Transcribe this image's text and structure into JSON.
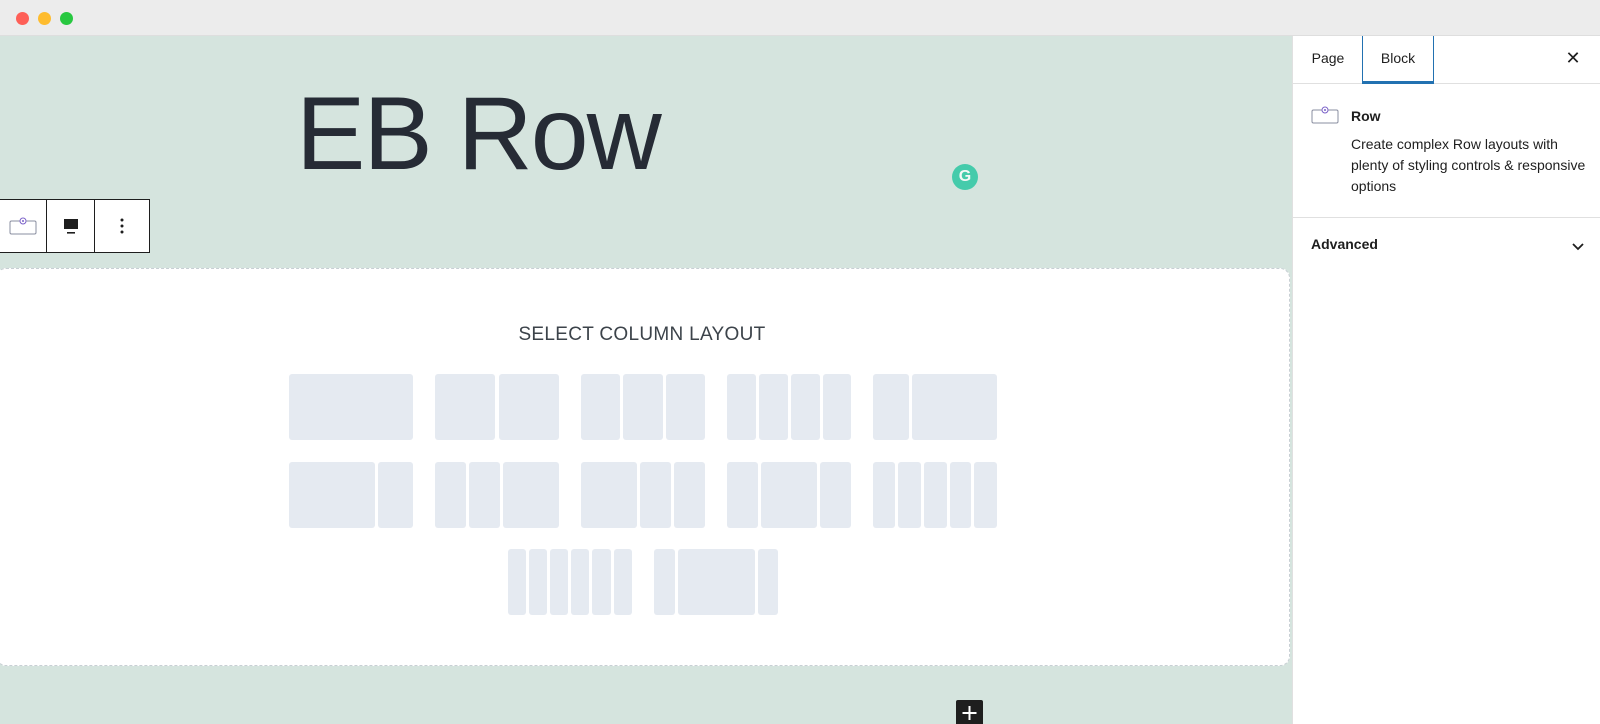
{
  "canvas": {
    "heading": "EB Row",
    "layout_title": "SELECT COLUMN LAYOUT",
    "layout_options": [
      {
        "name": "layout-1-col"
      },
      {
        "name": "layout-2-equal"
      },
      {
        "name": "layout-3-equal"
      },
      {
        "name": "layout-4-equal"
      },
      {
        "name": "layout-narrow-wide"
      },
      {
        "name": "layout-wide-narrow"
      },
      {
        "name": "layout-narrow-narrow-wide"
      },
      {
        "name": "layout-wide-narrow-narrow"
      },
      {
        "name": "layout-narrow-wide-narrow"
      },
      {
        "name": "layout-5-equal"
      },
      {
        "name": "layout-6-equal"
      },
      {
        "name": "layout-narrow-wide-narrow-alt"
      }
    ]
  },
  "toolbar": {
    "items": [
      "row-block-icon",
      "device-preview-icon",
      "more-options-icon"
    ]
  },
  "sidebar": {
    "tabs": [
      "Page",
      "Block"
    ],
    "active_tab": "Block",
    "close_label": "✕",
    "block": {
      "name": "Row",
      "description": "Create complex Row layouts with plenty of styling controls & responsive options"
    },
    "panel": {
      "label": "Advanced",
      "icon": "chevron-down-icon"
    }
  },
  "colors": {
    "canvas_bg": "#d5e4de",
    "accent": "#2271b1",
    "column_placeholder": "#e5eaf1",
    "grammarly": "#15c39a"
  }
}
